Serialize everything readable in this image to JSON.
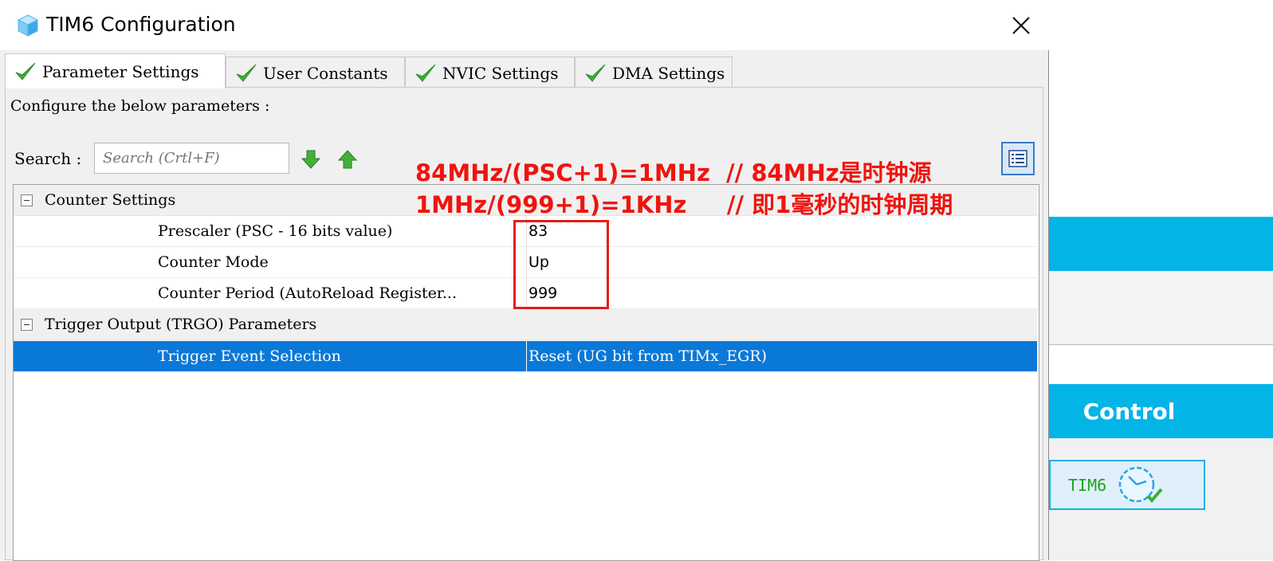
{
  "window": {
    "title": "TIM6 Configuration",
    "icon": "cube-icon",
    "close_icon": "close-icon"
  },
  "tabs": [
    {
      "label": "Parameter Settings",
      "icon": "green-check-icon",
      "active": true
    },
    {
      "label": "User Constants",
      "icon": "green-check-icon",
      "active": false
    },
    {
      "label": "NVIC Settings",
      "icon": "green-check-icon",
      "active": false
    },
    {
      "label": "DMA Settings",
      "icon": "green-check-icon",
      "active": false
    }
  ],
  "panel": {
    "caption": "Configure the below parameters :",
    "search_label": "Search :",
    "search_placeholder": "Search (Crtl+F)",
    "search_value": ""
  },
  "groups": [
    {
      "label": "Counter Settings",
      "params": [
        {
          "name": "Prescaler (PSC - 16 bits value)",
          "value": "83"
        },
        {
          "name": "Counter Mode",
          "value": "Up"
        },
        {
          "name": "Counter Period (AutoReload Register...",
          "value": "999"
        }
      ]
    },
    {
      "label": "Trigger Output (TRGO) Parameters",
      "params": [
        {
          "name": "Trigger Event Selection",
          "value": "Reset (UG bit from TIMx_EGR)",
          "selected": true
        }
      ]
    }
  ],
  "annotations": {
    "line1": "84MHz/(PSC+1)=1MHz  // 84MHz是时钟源",
    "line2": "1MHz/(999+1)=1KHz     // 即1毫秒的时钟周期"
  },
  "background_app": {
    "control_header": "Control",
    "tim6_card_label": "TIM6"
  },
  "colors": {
    "accent_blue": "#03b4e6",
    "selection_blue": "#0a78d7",
    "annotation_red": "#f0140f",
    "check_green": "#3cb034",
    "tim6_green": "#21a321"
  }
}
